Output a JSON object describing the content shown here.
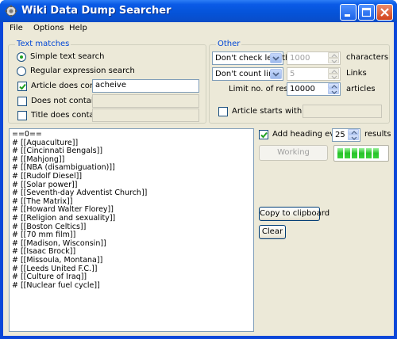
{
  "window": {
    "title": "Wiki Data Dump Searcher"
  },
  "menu": {
    "items": [
      "File",
      "Options",
      "Help"
    ]
  },
  "text_matches": {
    "legend": "Text matches",
    "simple_label": "Simple text search",
    "regex_label": "Regular expression search",
    "selected_mode": "simple",
    "contain": {
      "label": "Article does contain:",
      "checked": true,
      "value": "acheive"
    },
    "not_contain": {
      "label": "Does not contain:",
      "checked": false,
      "value": ""
    },
    "title_contain": {
      "label": "Title does contain:",
      "checked": false,
      "value": ""
    }
  },
  "other": {
    "legend": "Other",
    "length_select": "Don't check length",
    "length_value": "1000",
    "length_unit": "characters",
    "links_select": "Don't count links",
    "links_value": "5",
    "links_unit": "Links",
    "limit_label": "Limit no. of results",
    "limit_value": "10000",
    "limit_unit": "articles",
    "starts_with": {
      "label": "Article starts with:",
      "checked": false,
      "value": ""
    }
  },
  "output": {
    "lines": [
      "==0==",
      "# [[Aquaculture]]",
      "# [[Cincinnati Bengals]]",
      "# [[Mahjong]]",
      "# [[NBA (disambiguation)]]",
      "# [[Rudolf Diesel]]",
      "# [[Solar power]]",
      "# [[Seventh-day Adventist Church]]",
      "# [[The Matrix]]",
      "# [[Howard Walter Florey]]",
      "# [[Religion and sexuality]]",
      "# [[Boston Celtics]]",
      "# [[70 mm film]]",
      "# [[Madison, Wisconsin]]",
      "# [[Isaac Brock]]",
      "# [[Missoula, Montana]]",
      "# [[Leeds United F.C.]]",
      "# [[Culture of Iraq]]",
      "# [[Nuclear fuel cycle]]"
    ]
  },
  "heading": {
    "label": "Add heading every",
    "checked": true,
    "value": "25",
    "unit": "results"
  },
  "working_button": "Working",
  "progress": {
    "segments_filled": 6
  },
  "copy_button": "Copy to clipboard",
  "clear_button": "Clear",
  "colors": {
    "titlebar": "#0553d8",
    "client": "#ece9d8",
    "legend": "#0046d5",
    "progress": "#27c22a"
  }
}
